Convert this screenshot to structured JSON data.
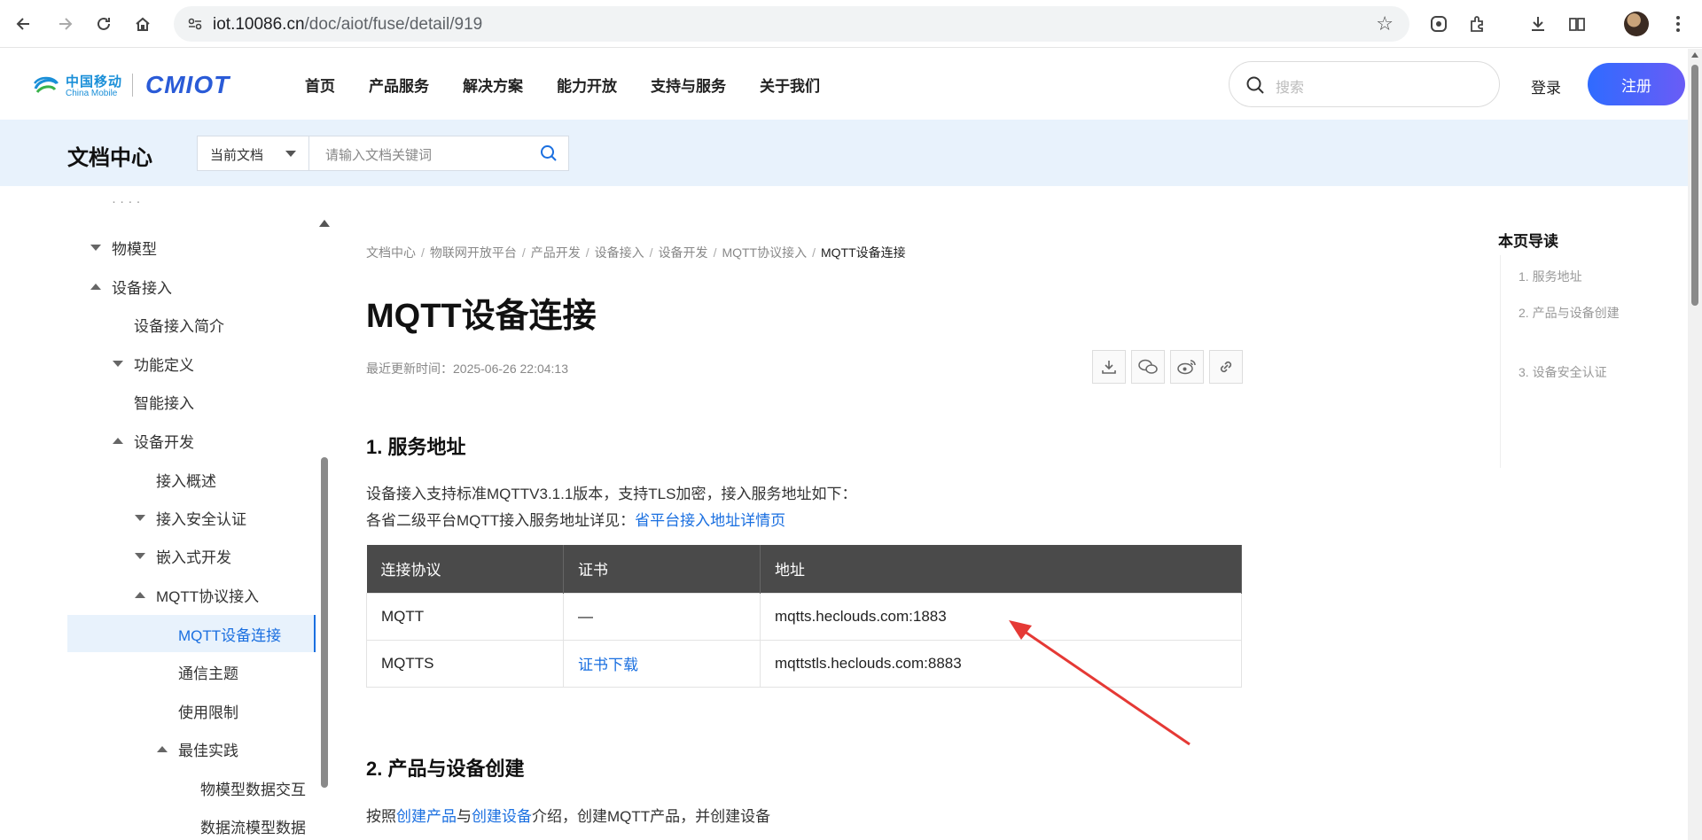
{
  "browser": {
    "url_host": "iot.10086.cn",
    "url_path": "/doc/aiot/fuse/detail/919"
  },
  "header": {
    "logo_cn": "中国移动",
    "logo_en": "China Mobile",
    "logo_brand": "CMIOT",
    "nav": [
      "首页",
      "产品服务",
      "解决方案",
      "能力开放",
      "支持与服务",
      "关于我们"
    ],
    "search_placeholder": "搜索",
    "login": "登录",
    "register": "注册"
  },
  "docbar": {
    "title": "文档中心",
    "scope": "当前文档",
    "search_placeholder": "请输入文档关键词"
  },
  "sidebar": {
    "items": [
      {
        "label": "物模型",
        "expand": "down"
      },
      {
        "label": "设备接入",
        "expand": "up"
      },
      {
        "label": "设备接入简介",
        "expand": ""
      },
      {
        "label": "功能定义",
        "expand": "down"
      },
      {
        "label": "智能接入",
        "expand": ""
      },
      {
        "label": "设备开发",
        "expand": "up"
      },
      {
        "label": "接入概述",
        "expand": ""
      },
      {
        "label": "接入安全认证",
        "expand": "down"
      },
      {
        "label": "嵌入式开发",
        "expand": "down"
      },
      {
        "label": "MQTT协议接入",
        "expand": "up"
      },
      {
        "label": "MQTT设备连接",
        "expand": "",
        "active": true
      },
      {
        "label": "通信主题",
        "expand": ""
      },
      {
        "label": "使用限制",
        "expand": ""
      },
      {
        "label": "最佳实践",
        "expand": "up"
      },
      {
        "label": "物模型数据交互",
        "expand": ""
      },
      {
        "label": "数据流模型数据",
        "expand": ""
      }
    ]
  },
  "breadcrumb": [
    "文档中心",
    "物联网开放平台",
    "产品开发",
    "设备接入",
    "设备开发",
    "MQTT协议接入",
    "MQTT设备连接"
  ],
  "article": {
    "title": "MQTT设备连接",
    "updated": "最近更新时间：2025-06-26 22:04:13",
    "section1_title": "1. 服务地址",
    "section1_line1": "设备接入支持标准MQTTV3.1.1版本，支持TLS加密，接入服务地址如下：",
    "section1_line2_prefix": "各省二级平台MQTT接入服务地址详见：",
    "section1_line2_link": "省平台接入地址详情页",
    "table": {
      "headers": [
        "连接协议",
        "证书",
        "地址"
      ],
      "rows": [
        {
          "protocol": "MQTT",
          "cert": "—",
          "address": "mqtts.heclouds.com:1883"
        },
        {
          "protocol": "MQTTS",
          "cert": "证书下载",
          "address": "mqttstls.heclouds.com:8883"
        }
      ]
    },
    "section2_title": "2. 产品与设备创建",
    "section2_prefix": "按照",
    "section2_link1": "创建产品",
    "section2_mid": "与",
    "section2_link2": "创建设备",
    "section2_suffix": "介绍，创建MQTT产品，并创建设备"
  },
  "toc": {
    "title": "本页导读",
    "items": [
      "1. 服务地址",
      "2. 产品与设备创建",
      "3. 设备安全认证"
    ]
  },
  "colors": {
    "accent": "#1a6fe0",
    "docbar_bg": "#e8f2fc",
    "table_header_bg": "#4a4a4a",
    "arrow": "#e53935"
  }
}
